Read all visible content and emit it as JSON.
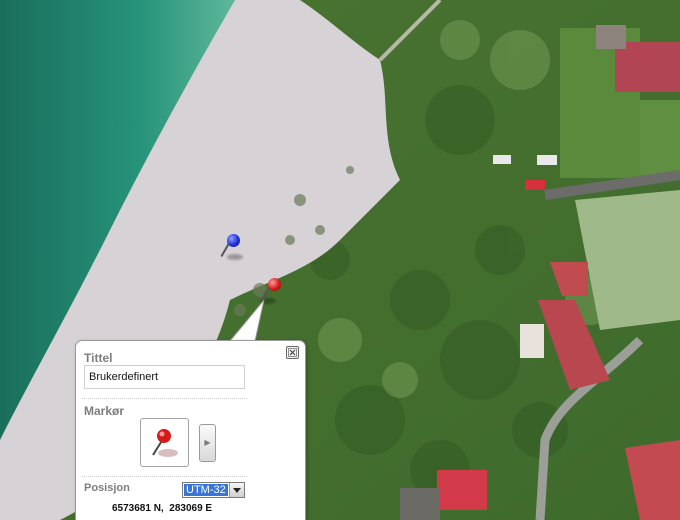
{
  "popup": {
    "title_label": "Tittel",
    "title_value": "Brukerdefinert",
    "marker_label": "Markør",
    "position_label": "Posisjon",
    "coordinate_system": {
      "selected": "UTM-32"
    },
    "coordinates": "6573681 N,  283069 E"
  },
  "markers": [
    {
      "name": "blue-pin",
      "color": "#1f2fd8"
    },
    {
      "name": "red-pin",
      "color": "#d61a1a"
    }
  ],
  "colors": {
    "sea": "#1f8a72",
    "beach": "#d7d3d6",
    "grass": "#4f7d34",
    "roof": "#c2404a",
    "label_gray": "#7d7d7d",
    "select_highlight": "#3875d7"
  }
}
